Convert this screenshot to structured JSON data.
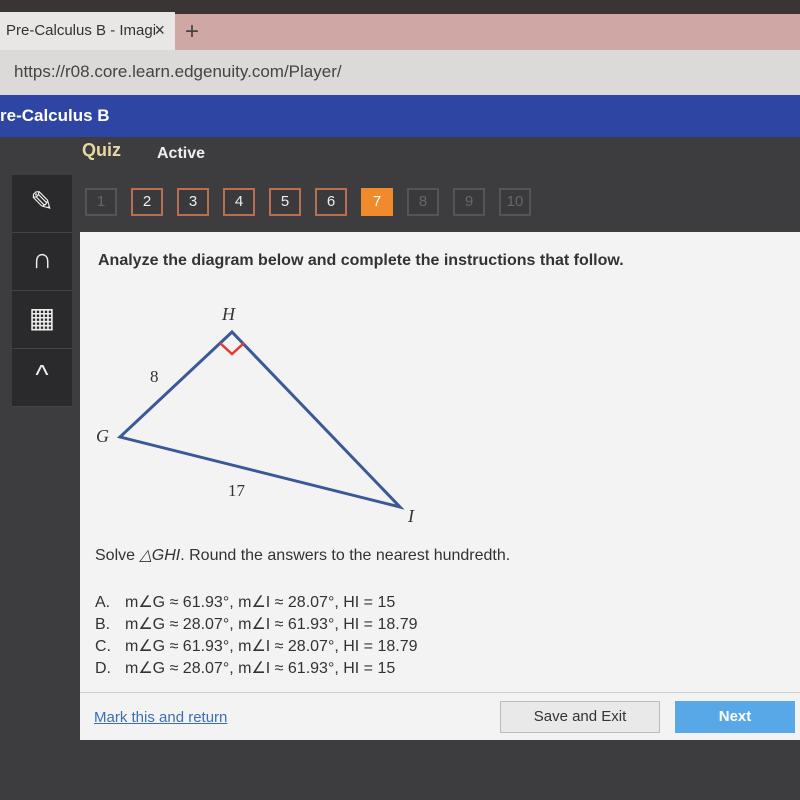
{
  "browser": {
    "tab_title": "Pre-Calculus B - Imagi",
    "close": "×",
    "new_tab": "+",
    "url": "https://r08.core.learn.edgenuity.com/Player/"
  },
  "header": {
    "title": "re-Calculus B"
  },
  "activity": {
    "type": "Quiz",
    "status": "Active"
  },
  "tools": [
    "pencil-icon",
    "headphones-icon",
    "calculator-icon",
    "collapse-icon"
  ],
  "questions": {
    "items": [
      "1",
      "2",
      "3",
      "4",
      "5",
      "6",
      "7",
      "8",
      "9",
      "10"
    ],
    "current": "7"
  },
  "question": {
    "prompt": "Analyze the diagram below and complete the instructions that follow.",
    "diagram": {
      "vertices": {
        "G": "G",
        "H": "H",
        "I": "I"
      },
      "side_gh": "8",
      "side_gi": "17",
      "right_angle_at": "H"
    },
    "instruction_pre": "Solve ",
    "instruction_tri": "△GHI",
    "instruction_post": ". Round the answers to the nearest hundredth.",
    "options": [
      {
        "letter": "A.",
        "text": "m∠G ≈ 61.93°, m∠I ≈ 28.07°, HI = 15"
      },
      {
        "letter": "B.",
        "text": "m∠G ≈ 28.07°, m∠I ≈ 61.93°, HI = 18.79"
      },
      {
        "letter": "C.",
        "text": "m∠G ≈ 61.93°, m∠I ≈ 28.07°, HI = 18.79"
      },
      {
        "letter": "D.",
        "text": "m∠G ≈ 28.07°, m∠I ≈ 61.93°, HI = 15"
      }
    ]
  },
  "footer": {
    "mark": "Mark this and return",
    "save": "Save and Exit",
    "next": "Next"
  },
  "colors": {
    "header": "#2e45a4",
    "current_question": "#f08a2c",
    "triangle": "#3b5998",
    "right_angle": "#e53935",
    "next": "#58a8e8"
  }
}
